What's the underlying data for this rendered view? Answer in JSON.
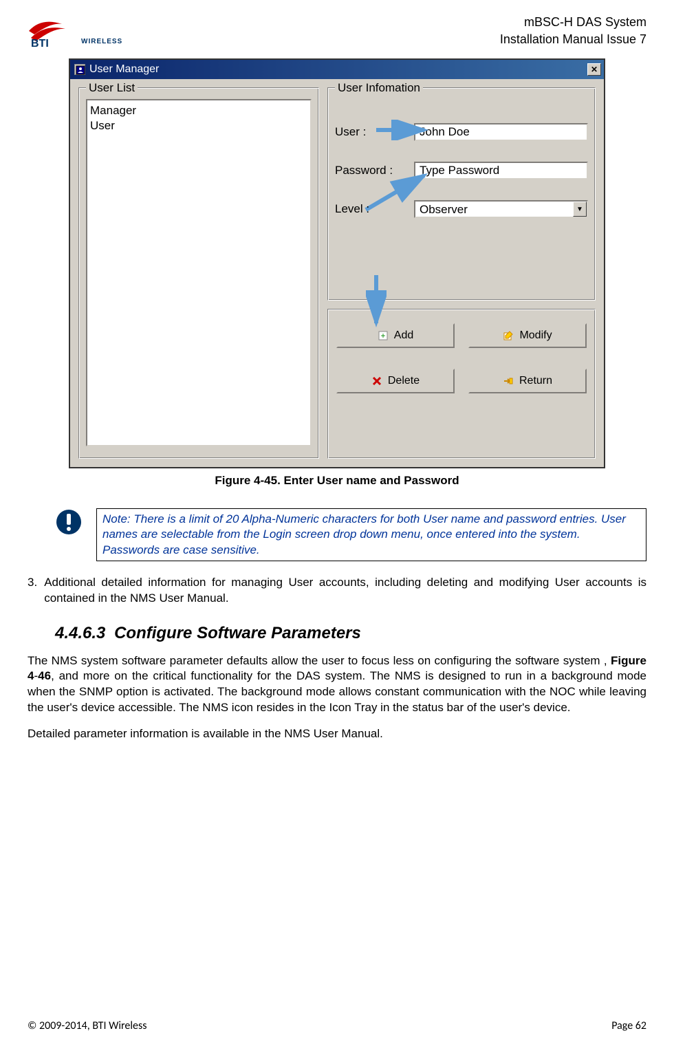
{
  "header": {
    "line1": "mBSC-H DAS System",
    "line2": "Installation Manual Issue 7",
    "logo_text": "WIRELESS"
  },
  "dialog": {
    "title": "User Manager",
    "userlist": {
      "title": "User List",
      "items": [
        "Manager",
        "User"
      ]
    },
    "userinfo": {
      "title": "User Infomation",
      "user_label": "User :",
      "user_value": "John Doe",
      "password_label": "Password :",
      "password_value": "Type Password",
      "level_label": "Level :",
      "level_value": "Observer"
    },
    "buttons": {
      "add": "Add",
      "modify": "Modify",
      "delete": "Delete",
      "return": "Return"
    }
  },
  "figure_caption": "Figure 4-45. Enter User name and Password",
  "note": "Note: There is a limit of 20 Alpha-Numeric characters for both User name and password entries. User names are selectable from the Login screen drop down menu, once entered into the system. Passwords are case sensitive.",
  "para3_num": "3.",
  "para3": "Additional detailed information for managing User accounts, including deleting and modifying User accounts is contained in the NMS User Manual.",
  "section": {
    "number": "4.4.6.3",
    "title": "Configure Software Parameters"
  },
  "section_p1_a": "The NMS system software parameter defaults allow the user to focus less on configuring the software system , ",
  "section_p1_b": "Figure 4",
  "section_p1_c": "-",
  "section_p1_d": "46",
  "section_p1_e": ", and more on the critical functionality for the DAS system. The NMS is designed to run in a background mode when the SNMP option is activated. The background mode allows constant communication with the NOC while leaving the user's device accessible. The NMS icon resides in the Icon Tray in the status bar of the user's device.",
  "section_p2": "Detailed parameter information is available in the NMS User Manual.",
  "footer": {
    "left": "© 2009-2014, BTI Wireless",
    "right": "Page 62"
  }
}
